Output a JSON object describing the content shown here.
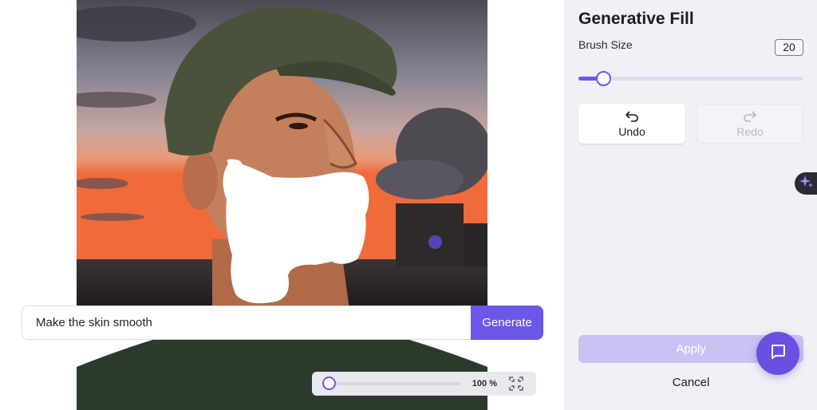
{
  "prompt": {
    "value": "Make the skin smooth",
    "generate_label": "Generate"
  },
  "zoom": {
    "label": "100 %",
    "slider_fraction": 0.03
  },
  "panel": {
    "title": "Generative Fill",
    "brush_size_label": "Brush Size",
    "brush_size_value": "20",
    "brush_slider_fraction": 0.11,
    "undo_label": "Undo",
    "redo_label": "Redo",
    "apply_label": "Apply",
    "cancel_label": "Cancel"
  },
  "colors": {
    "accent": "#6b57e8",
    "apply_disabled": "#c9c3f3",
    "panel_bg": "#f0f0f6",
    "fab": "#6b4fe0"
  },
  "icons": {
    "undo": "undo-icon",
    "redo": "redo-icon",
    "fit": "fit-screen-icon",
    "sparkle": "sparkle-icon",
    "chat": "chat-icon"
  }
}
